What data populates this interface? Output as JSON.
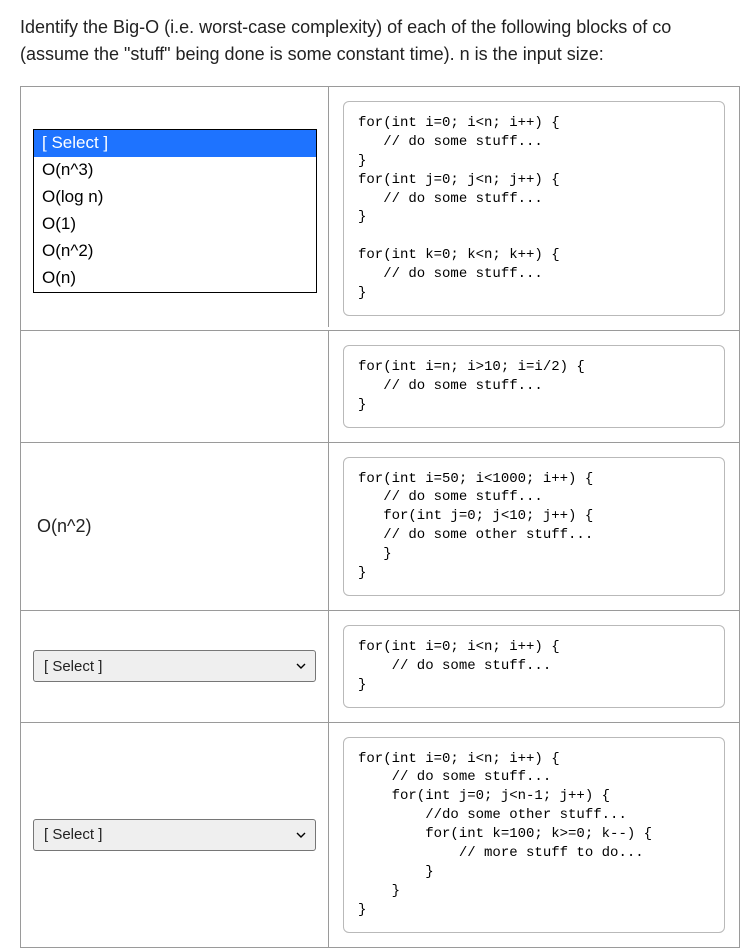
{
  "prompt": {
    "line1": "Identify the Big-O (i.e. worst-case complexity) of each of the following blocks of co",
    "line2": "(assume the \"stuff\" being done is some constant time). n is the input size:"
  },
  "select_placeholder": "[ Select ]",
  "dropdown": {
    "options": [
      "[ Select ]",
      "O(n^3)",
      "O(log n)",
      "O(1)",
      "O(n^2)",
      "O(n)"
    ],
    "selected_index": 0
  },
  "row1_ghost": "[ Select ]",
  "row3_answer": "O(n^2)",
  "code": {
    "block1": "for(int i=0; i<n; i++) {\n   // do some stuff...\n}\nfor(int j=0; j<n; j++) {\n   // do some stuff...\n}\n\nfor(int k=0; k<n; k++) {\n   // do some stuff...\n}",
    "block2": "for(int i=n; i>10; i=i/2) {\n   // do some stuff...\n}",
    "block3": "for(int i=50; i<1000; i++) {\n   // do some stuff...\n   for(int j=0; j<10; j++) {\n   // do some other stuff...\n   }\n}",
    "block4": "for(int i=0; i<n; i++) {\n    // do some stuff...\n}",
    "block5": "for(int i=0; i<n; i++) {\n    // do some stuff...\n    for(int j=0; j<n-1; j++) {\n        //do some other stuff...\n        for(int k=100; k>=0; k--) {\n            // more stuff to do...\n        }\n    }\n}"
  }
}
